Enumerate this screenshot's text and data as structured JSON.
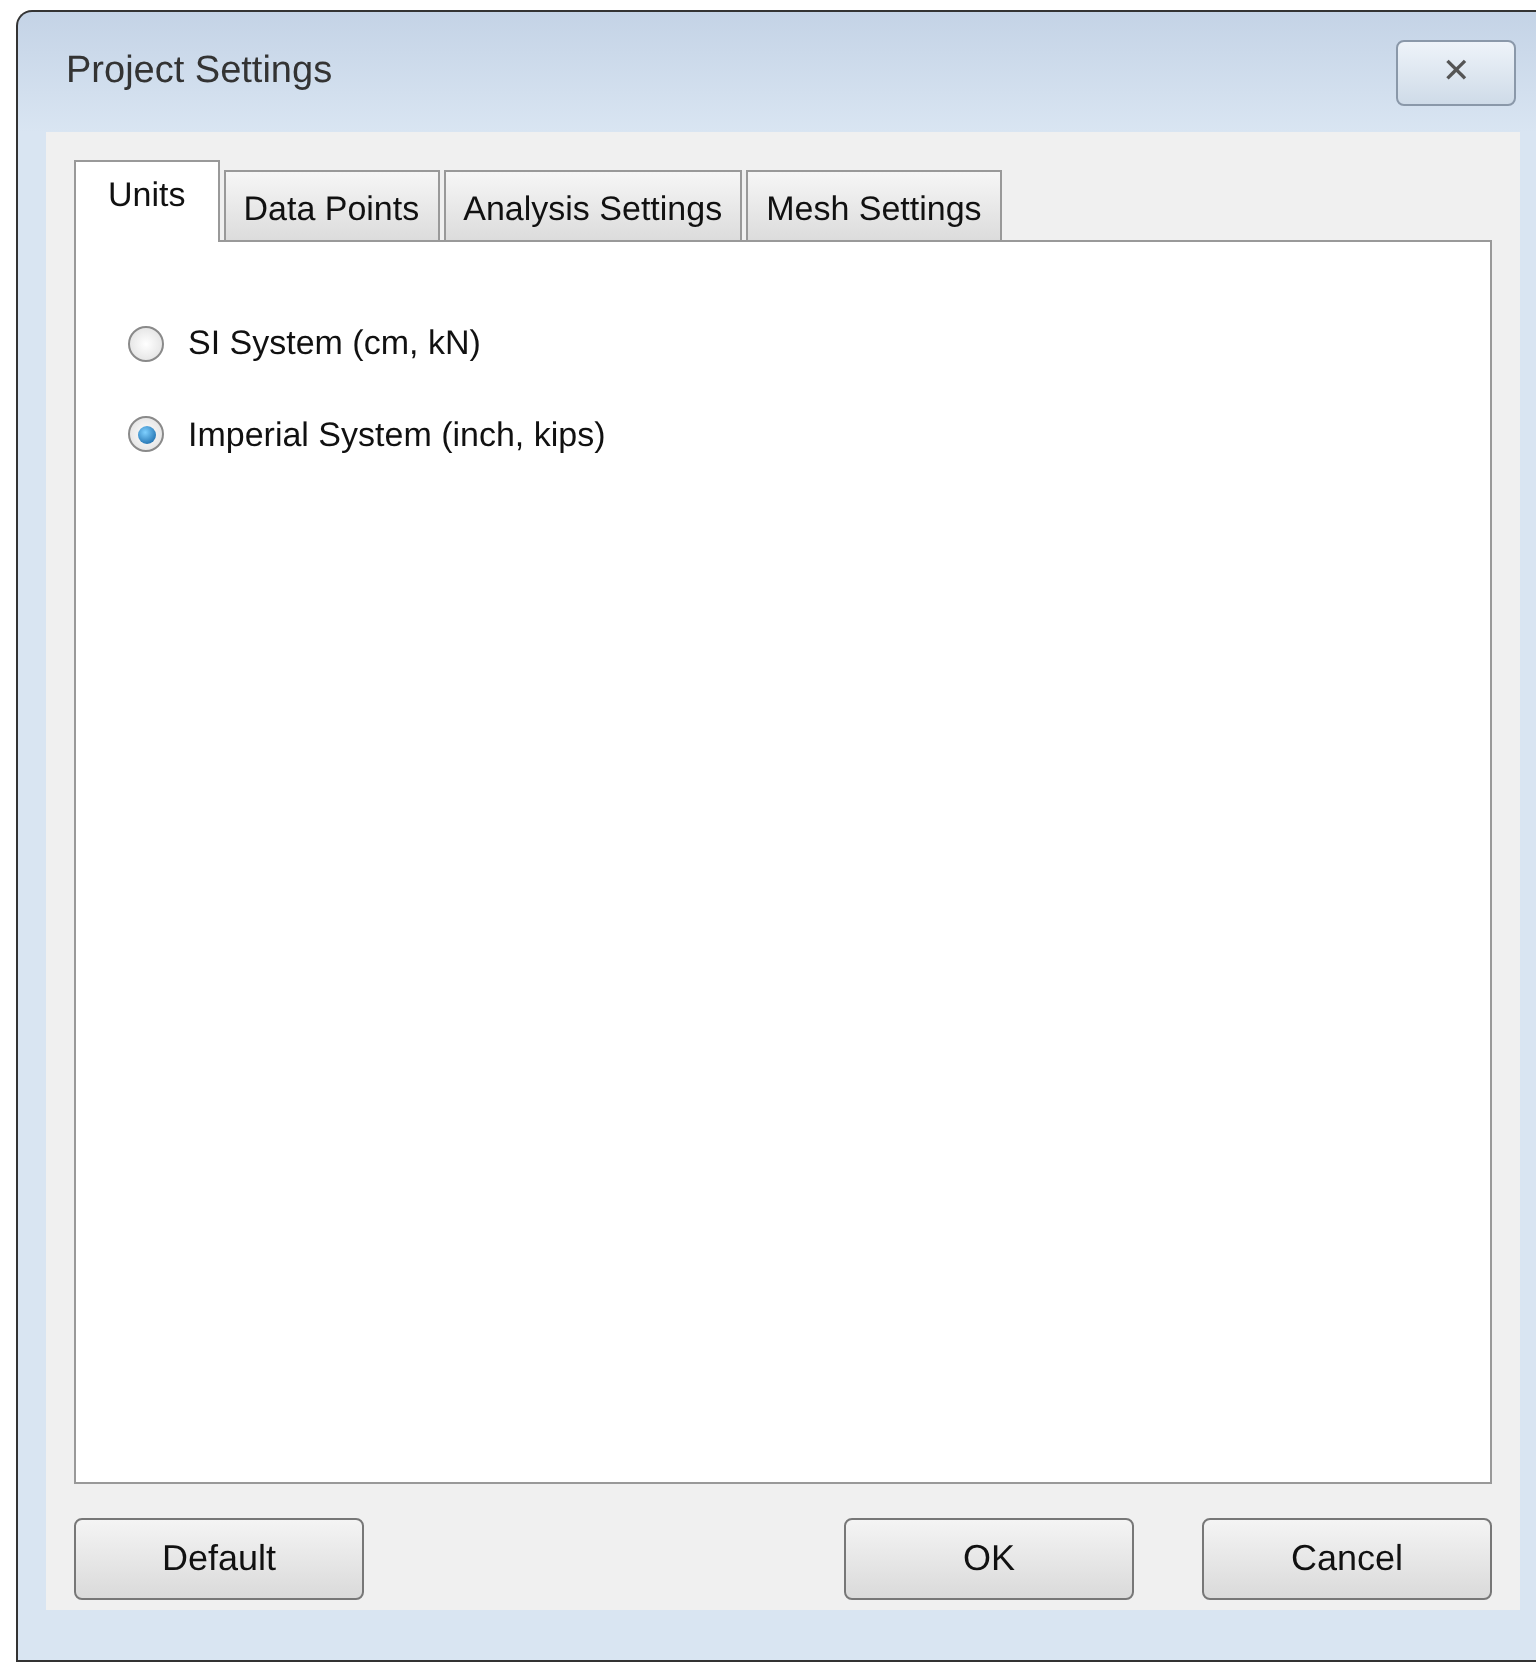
{
  "window": {
    "title": "Project Settings",
    "close_label": "✕"
  },
  "tabs": [
    {
      "label": "Units",
      "selected": true
    },
    {
      "label": "Data Points",
      "selected": false
    },
    {
      "label": "Analysis Settings",
      "selected": false
    },
    {
      "label": "Mesh Settings",
      "selected": false
    }
  ],
  "unit_options": [
    {
      "label": "SI System (cm, kN)",
      "selected": false
    },
    {
      "label": "Imperial System (inch, kips)",
      "selected": true
    }
  ],
  "buttons": {
    "left": [
      "Default"
    ],
    "right": [
      "OK",
      "Cancel"
    ]
  }
}
